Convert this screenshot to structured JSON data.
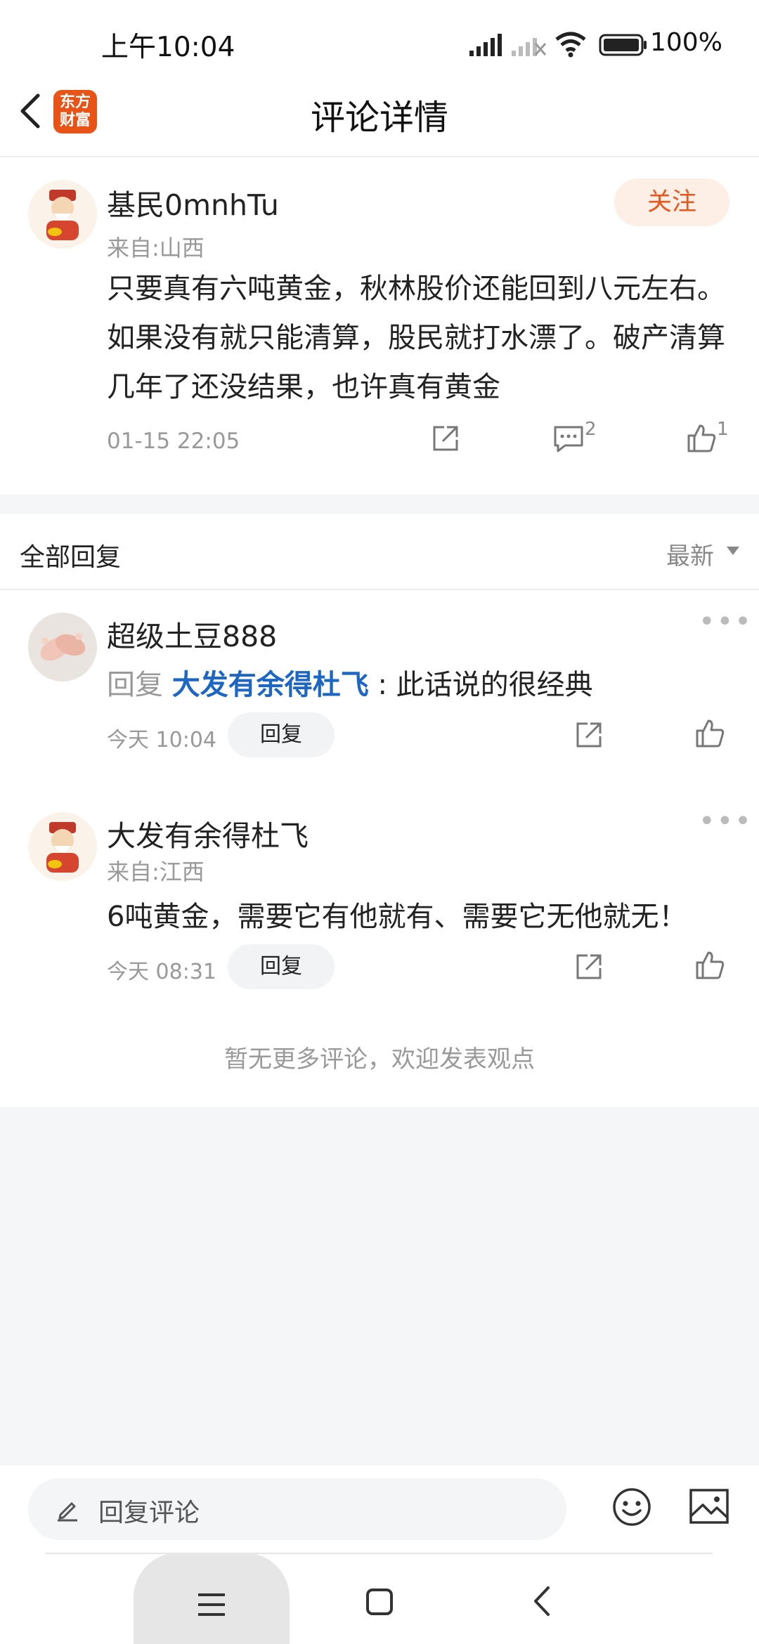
{
  "status_bar": {
    "time": "上午10:04",
    "battery": "100%"
  },
  "header": {
    "title": "评论详情",
    "logo_line1": "东方",
    "logo_line2": "财富"
  },
  "main_comment": {
    "user": "基民0mnhTu",
    "location": "来自:山西",
    "follow_label": "关注",
    "text": "只要真有六吨黄金，秋林股价还能回到八元左右。如果没有就只能清算，股民就打水漂了。破产清算几年了还没结果，也许真有黄金",
    "date": "01-15 22:05",
    "comment_count": "2",
    "like_count": "1"
  },
  "replies": {
    "title": "全部回复",
    "sort": "最新",
    "items": [
      {
        "user": "超级土豆888",
        "reply_prefix": "回复",
        "reply_target": "大发有余得杜飞",
        "text": ": 此话说的很经典",
        "date": "今天 10:04",
        "reply_label": "回复"
      },
      {
        "user": "大发有余得杜飞",
        "location": "来自:江西",
        "text": "6吨黄金，需要它有他就有、需要它无他就无！",
        "date": "今天 08:31",
        "reply_label": "回复"
      }
    ],
    "no_more": "暂无更多评论，欢迎发表观点"
  },
  "bottom": {
    "input_placeholder": "回复评论"
  },
  "colors": {
    "accent": "#e8581c",
    "link": "#1d66c4",
    "logo": "#e85418"
  }
}
